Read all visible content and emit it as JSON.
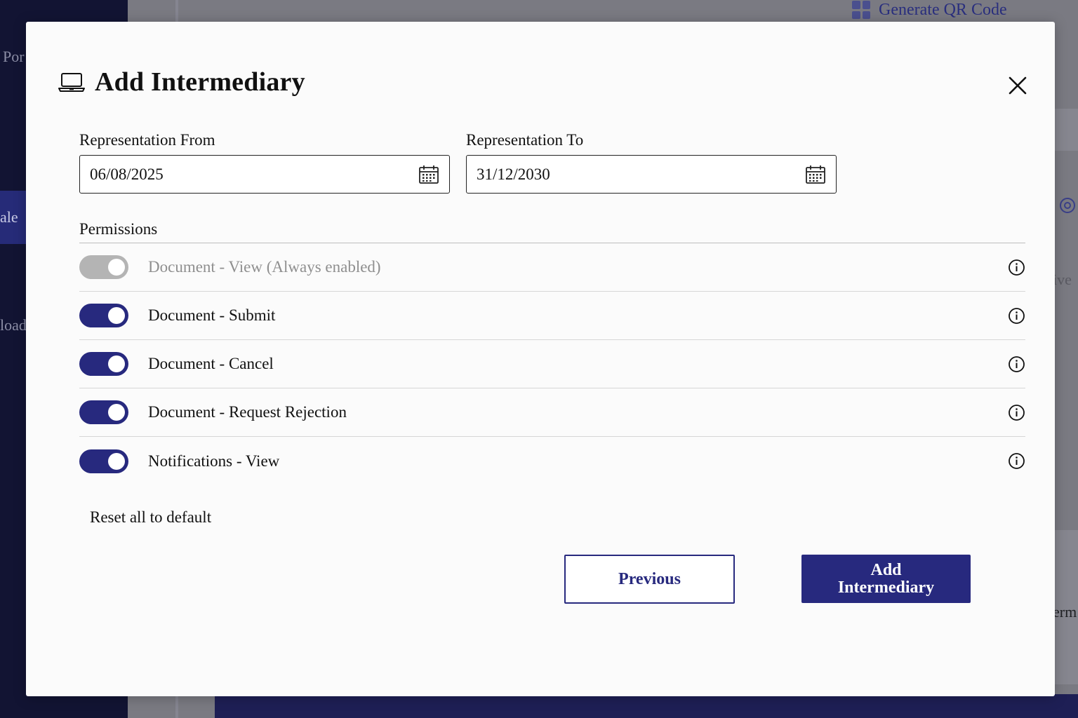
{
  "background": {
    "sidebar_fragments": [
      "Por",
      "ale",
      "load"
    ],
    "generate_qr_label": "Generate QR Code",
    "right_fragments": [
      "ive",
      "erm"
    ]
  },
  "modal": {
    "title": "Add Intermediary",
    "title_icon": "laptop-icon",
    "close_icon": "close-icon",
    "representation_from": {
      "label": "Representation From",
      "value": "06/08/2025",
      "icon": "calendar-icon"
    },
    "representation_to": {
      "label": "Representation To",
      "value": "31/12/2030",
      "icon": "calendar-icon"
    },
    "permissions_title": "Permissions",
    "permissions": [
      {
        "label": "Document - View (Always enabled)",
        "enabled": true,
        "disabled": true
      },
      {
        "label": "Document - Submit",
        "enabled": true,
        "disabled": false
      },
      {
        "label": "Document - Cancel",
        "enabled": true,
        "disabled": false
      },
      {
        "label": "Document - Request Rejection",
        "enabled": true,
        "disabled": false
      },
      {
        "label": "Notifications - View",
        "enabled": true,
        "disabled": false
      }
    ],
    "reset_label": "Reset all to default",
    "previous_label": "Previous",
    "add_label": "Add Intermediary"
  },
  "colors": {
    "primary": "#27297e",
    "disabled_toggle": "#b4b4b4"
  }
}
